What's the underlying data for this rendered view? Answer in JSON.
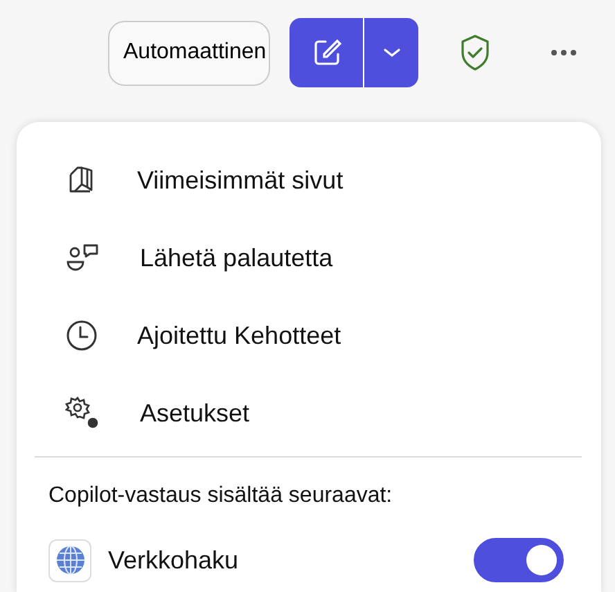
{
  "toolbar": {
    "mode_dropdown": {
      "value": "Automaattinen"
    }
  },
  "menu": {
    "items": [
      {
        "label": "Viimeisimmät sivut"
      },
      {
        "label": "Lähetä palautetta"
      },
      {
        "label": "Ajoitettu Kehotteet"
      },
      {
        "label": "Asetukset"
      }
    ],
    "section_heading": "Copilot-vastaus sisältää seuraavat:",
    "toggles": [
      {
        "label": "Verkkohaku",
        "on": true
      }
    ]
  }
}
